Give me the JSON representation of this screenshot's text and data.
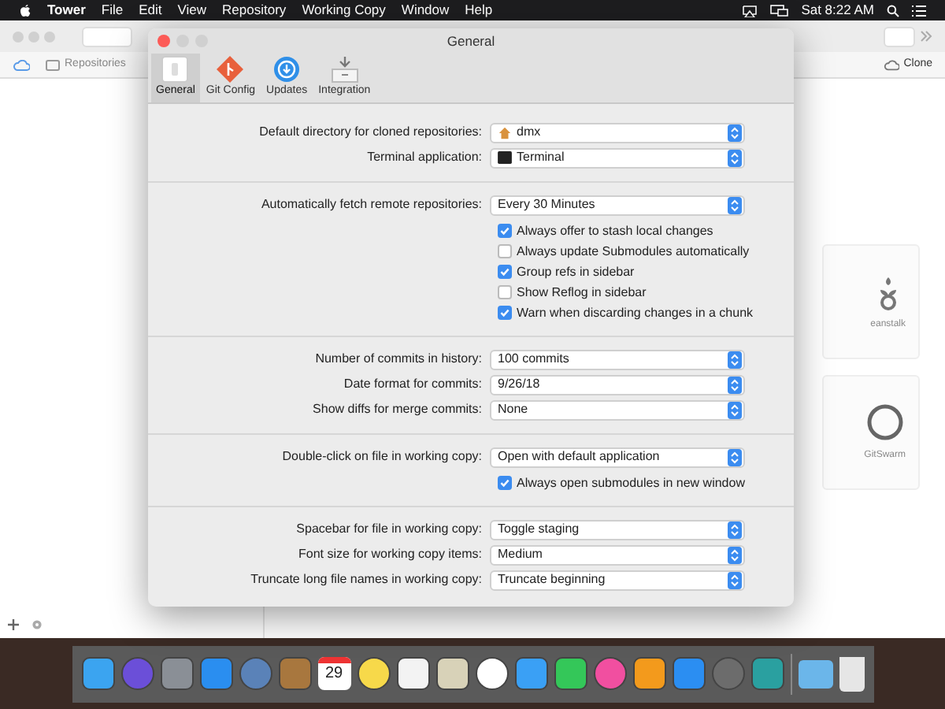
{
  "menubar": {
    "app": "Tower",
    "menus": [
      "File",
      "Edit",
      "View",
      "Repository",
      "Working Copy",
      "Window",
      "Help"
    ],
    "clock": "Sat 8:22 AM"
  },
  "main_window": {
    "repositories_button": "Repositories",
    "clone_button": "Clone",
    "services": [
      "eanstalk",
      "GitSwarm"
    ]
  },
  "dialog": {
    "title": "General",
    "tabs": [
      {
        "label": "General",
        "kind": "general",
        "selected": true
      },
      {
        "label": "Git Config",
        "kind": "git",
        "selected": false
      },
      {
        "label": "Updates",
        "kind": "updates",
        "selected": false
      },
      {
        "label": "Integration",
        "kind": "integration",
        "selected": false
      }
    ],
    "sections": [
      {
        "rows": [
          {
            "label": "Default directory for cloned repositories:",
            "value": "dmx",
            "kind": "home"
          },
          {
            "label": "Terminal application:",
            "value": "Terminal",
            "kind": "terminal"
          }
        ]
      },
      {
        "rows": [
          {
            "label": "Automatically fetch remote repositories:",
            "value": "Every 30 Minutes"
          }
        ],
        "checkboxes": [
          {
            "label": "Always offer to stash local changes",
            "checked": true
          },
          {
            "label": "Always update Submodules automatically",
            "checked": false
          },
          {
            "label": "Group refs in sidebar",
            "checked": true
          },
          {
            "label": "Show Reflog in sidebar",
            "checked": false
          },
          {
            "label": "Warn when discarding changes in a chunk",
            "checked": true
          }
        ]
      },
      {
        "rows": [
          {
            "label": "Number of commits in history:",
            "value": "100 commits"
          },
          {
            "label": "Date format for commits:",
            "value": "9/26/18"
          },
          {
            "label": "Show diffs for merge commits:",
            "value": "None"
          }
        ]
      },
      {
        "rows": [
          {
            "label": "Double-click on file in working copy:",
            "value": "Open with default application"
          }
        ],
        "checkboxes": [
          {
            "label": "Always open submodules in new window",
            "checked": true
          }
        ]
      },
      {
        "rows": [
          {
            "label": "Spacebar for file in working copy:",
            "value": "Toggle staging"
          },
          {
            "label": "Font size for working copy items:",
            "value": "Medium"
          },
          {
            "label": "Truncate long file names in working copy:",
            "value": "Truncate beginning"
          }
        ]
      }
    ]
  },
  "dock": {
    "calendar_day": "29"
  }
}
